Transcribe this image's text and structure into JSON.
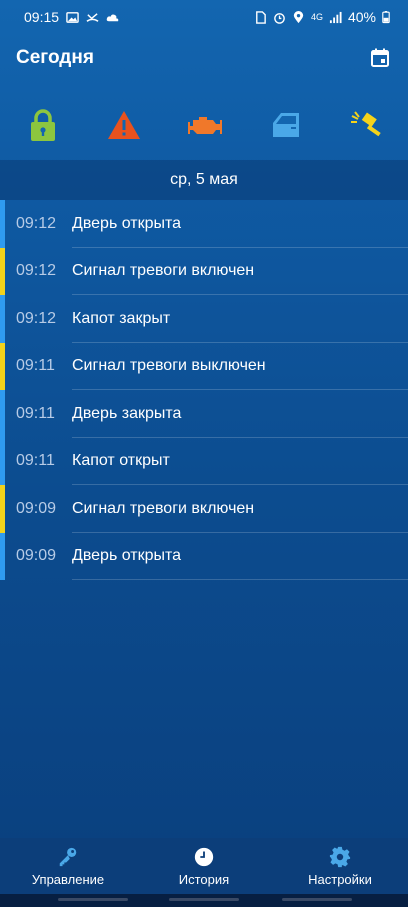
{
  "status_bar": {
    "time": "09:15",
    "battery": "40%",
    "network": "4G"
  },
  "app_bar": {
    "title": "Сегодня",
    "calendar_icon": "calendar-icon"
  },
  "sensors": [
    {
      "name": "lock-icon",
      "color": "#8cc63f"
    },
    {
      "name": "alarm-triangle-icon",
      "color": "#e8521e"
    },
    {
      "name": "engine-icon",
      "color": "#f0782a"
    },
    {
      "name": "door-icon",
      "color": "#4aa8e8"
    },
    {
      "name": "shock-hammer-icon",
      "color": "#f5d31a"
    }
  ],
  "date_header": "ср, 5 мая",
  "colors": {
    "blue_accent": "#2f9bf0",
    "yellow_accent": "#f2d21b"
  },
  "events": [
    {
      "time": "09:12",
      "text": "Дверь открыта",
      "accent": "#2f9bf0"
    },
    {
      "time": "09:12",
      "text": "Сигнал тревоги включен",
      "accent": "#f2d21b"
    },
    {
      "time": "09:12",
      "text": "Капот закрыт",
      "accent": "#2f9bf0"
    },
    {
      "time": "09:11",
      "text": "Сигнал тревоги выключен",
      "accent": "#f2d21b"
    },
    {
      "time": "09:11",
      "text": "Дверь закрыта",
      "accent": "#2f9bf0"
    },
    {
      "time": "09:11",
      "text": "Капот открыт",
      "accent": "#2f9bf0"
    },
    {
      "time": "09:09",
      "text": "Сигнал тревоги включен",
      "accent": "#f2d21b"
    },
    {
      "time": "09:09",
      "text": "Дверь открыта",
      "accent": "#2f9bf0"
    }
  ],
  "bottom_nav": [
    {
      "label": "Управление",
      "icon": "key-icon"
    },
    {
      "label": "История",
      "icon": "clock-icon"
    },
    {
      "label": "Настройки",
      "icon": "gear-icon"
    }
  ]
}
